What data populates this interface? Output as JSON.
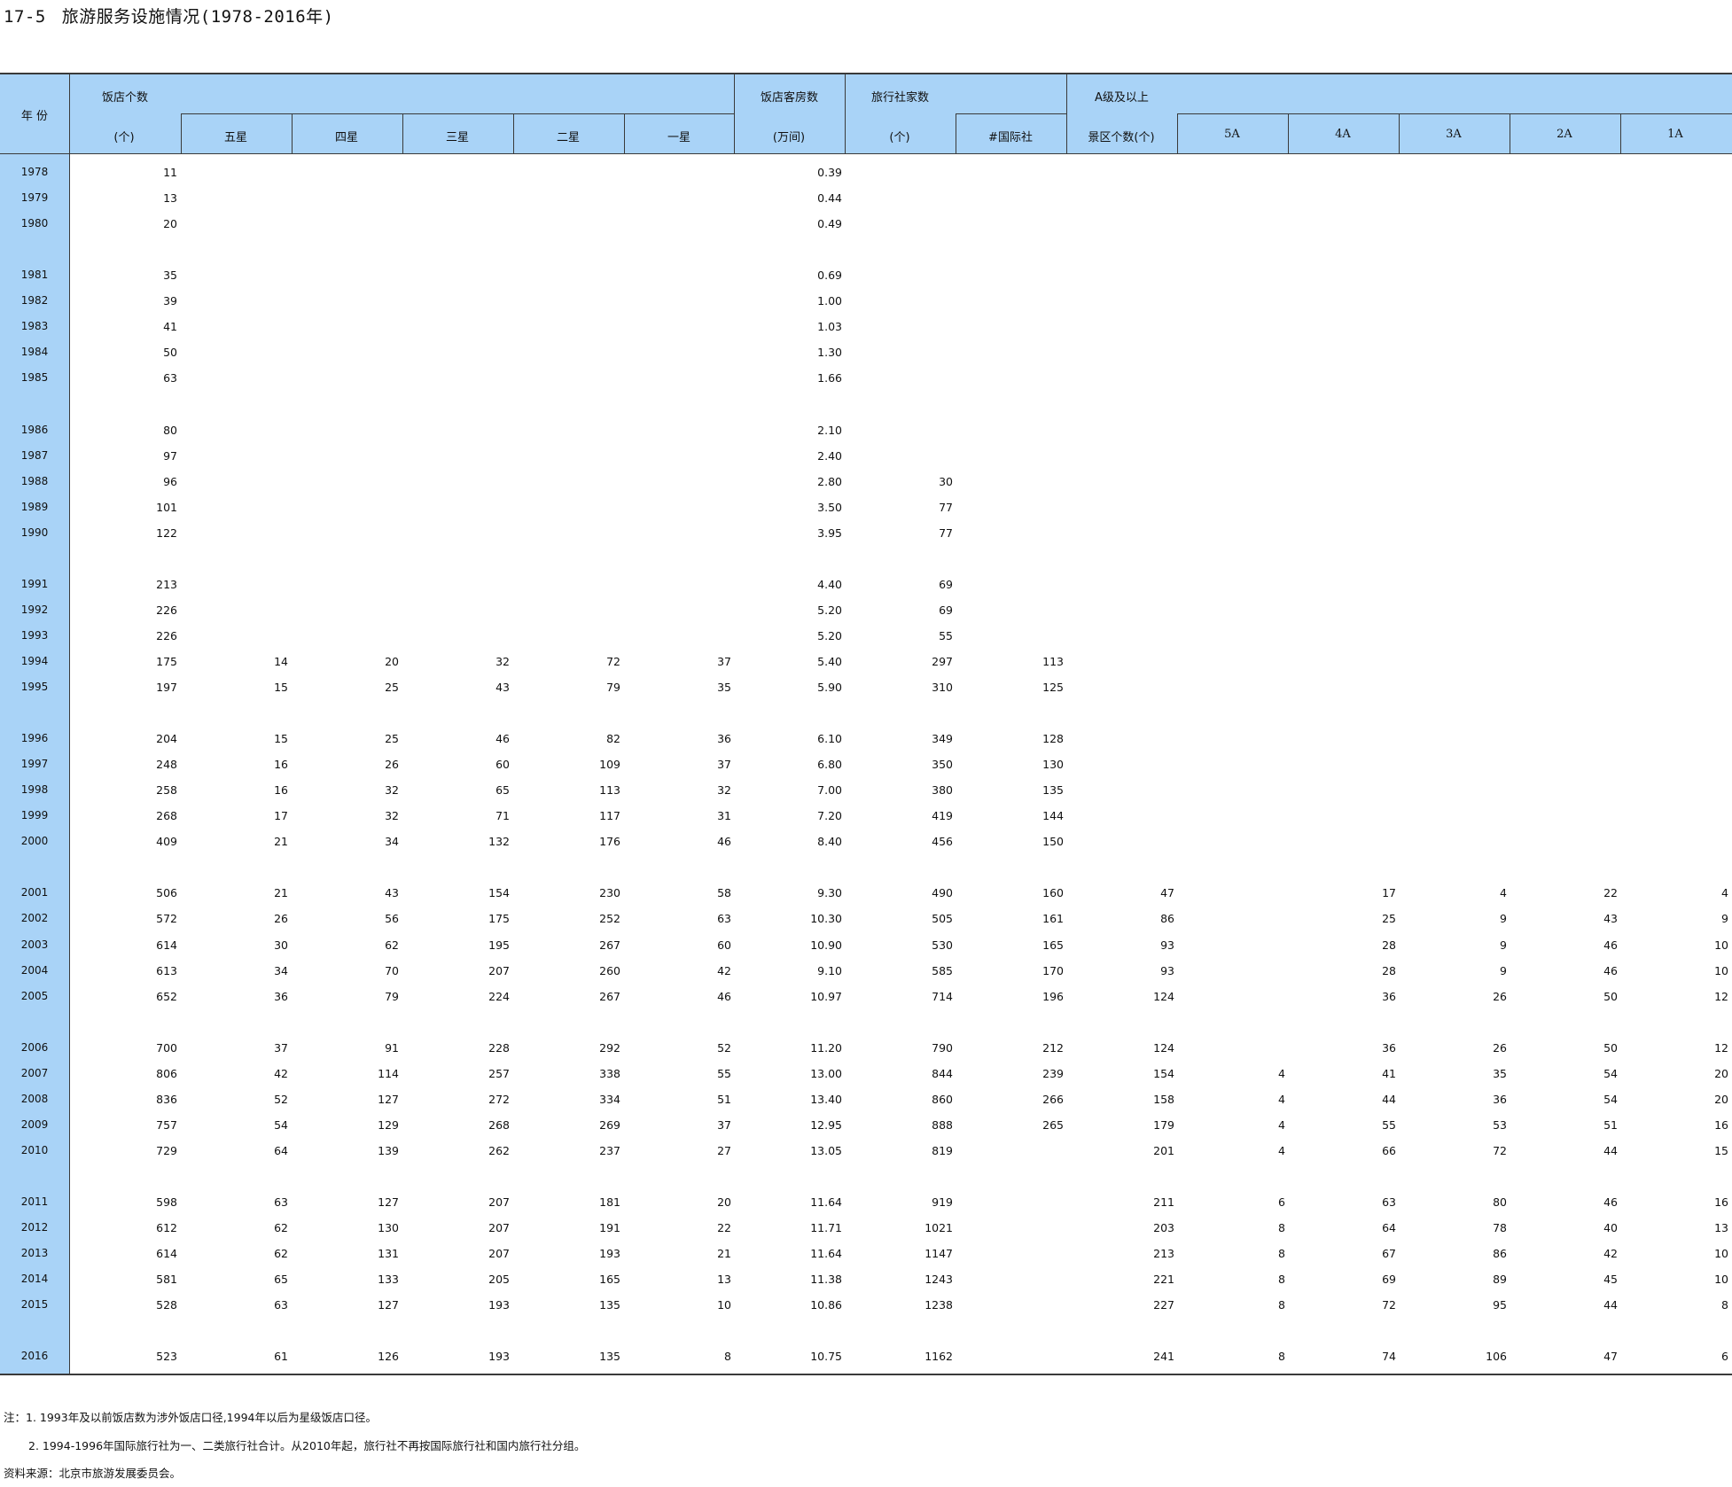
{
  "title": {
    "number": "17-5",
    "text": "旅游服务设施情况(1978-2016年)"
  },
  "header": {
    "year": "年 份",
    "hotels": "饭店个数",
    "hotels_unit": "(个)",
    "five_star": "五星",
    "four_star": "四星",
    "three_star": "三星",
    "two_star": "二星",
    "one_star": "一星",
    "rooms": "饭店客房数",
    "rooms_unit": "(万间)",
    "agencies": "旅行社家数",
    "agencies_unit": "(个)",
    "intl": "#国际社",
    "a_level": "A级及以上",
    "scenic_count": "景区个数(个)",
    "a5": "5A",
    "a4": "4A",
    "a3": "3A",
    "a2": "2A",
    "a1": "1A"
  },
  "columns": [
    "year",
    "hotels",
    "five",
    "four",
    "three",
    "two",
    "one",
    "rooms",
    "agencies",
    "intl",
    "scenic",
    "a5",
    "a4",
    "a3",
    "a2",
    "a1"
  ],
  "rows": [
    [
      "1978",
      "11",
      "",
      "",
      "",
      "",
      "",
      "0.39",
      "",
      "",
      "",
      "",
      "",
      "",
      "",
      ""
    ],
    [
      "1979",
      "13",
      "",
      "",
      "",
      "",
      "",
      "0.44",
      "",
      "",
      "",
      "",
      "",
      "",
      "",
      ""
    ],
    [
      "1980",
      "20",
      "",
      "",
      "",
      "",
      "",
      "0.49",
      "",
      "",
      "",
      "",
      "",
      "",
      "",
      ""
    ],
    [
      "1981",
      "35",
      "",
      "",
      "",
      "",
      "",
      "0.69",
      "",
      "",
      "",
      "",
      "",
      "",
      "",
      ""
    ],
    [
      "1982",
      "39",
      "",
      "",
      "",
      "",
      "",
      "1.00",
      "",
      "",
      "",
      "",
      "",
      "",
      "",
      ""
    ],
    [
      "1983",
      "41",
      "",
      "",
      "",
      "",
      "",
      "1.03",
      "",
      "",
      "",
      "",
      "",
      "",
      "",
      ""
    ],
    [
      "1984",
      "50",
      "",
      "",
      "",
      "",
      "",
      "1.30",
      "",
      "",
      "",
      "",
      "",
      "",
      "",
      ""
    ],
    [
      "1985",
      "63",
      "",
      "",
      "",
      "",
      "",
      "1.66",
      "",
      "",
      "",
      "",
      "",
      "",
      "",
      ""
    ],
    [
      "1986",
      "80",
      "",
      "",
      "",
      "",
      "",
      "2.10",
      "",
      "",
      "",
      "",
      "",
      "",
      "",
      ""
    ],
    [
      "1987",
      "97",
      "",
      "",
      "",
      "",
      "",
      "2.40",
      "",
      "",
      "",
      "",
      "",
      "",
      "",
      ""
    ],
    [
      "1988",
      "96",
      "",
      "",
      "",
      "",
      "",
      "2.80",
      "30",
      "",
      "",
      "",
      "",
      "",
      "",
      ""
    ],
    [
      "1989",
      "101",
      "",
      "",
      "",
      "",
      "",
      "3.50",
      "77",
      "",
      "",
      "",
      "",
      "",
      "",
      ""
    ],
    [
      "1990",
      "122",
      "",
      "",
      "",
      "",
      "",
      "3.95",
      "77",
      "",
      "",
      "",
      "",
      "",
      "",
      ""
    ],
    [
      "1991",
      "213",
      "",
      "",
      "",
      "",
      "",
      "4.40",
      "69",
      "",
      "",
      "",
      "",
      "",
      "",
      ""
    ],
    [
      "1992",
      "226",
      "",
      "",
      "",
      "",
      "",
      "5.20",
      "69",
      "",
      "",
      "",
      "",
      "",
      "",
      ""
    ],
    [
      "1993",
      "226",
      "",
      "",
      "",
      "",
      "",
      "5.20",
      "55",
      "",
      "",
      "",
      "",
      "",
      "",
      ""
    ],
    [
      "1994",
      "175",
      "14",
      "20",
      "32",
      "72",
      "37",
      "5.40",
      "297",
      "113",
      "",
      "",
      "",
      "",
      "",
      ""
    ],
    [
      "1995",
      "197",
      "15",
      "25",
      "43",
      "79",
      "35",
      "5.90",
      "310",
      "125",
      "",
      "",
      "",
      "",
      "",
      ""
    ],
    [
      "1996",
      "204",
      "15",
      "25",
      "46",
      "82",
      "36",
      "6.10",
      "349",
      "128",
      "",
      "",
      "",
      "",
      "",
      ""
    ],
    [
      "1997",
      "248",
      "16",
      "26",
      "60",
      "109",
      "37",
      "6.80",
      "350",
      "130",
      "",
      "",
      "",
      "",
      "",
      ""
    ],
    [
      "1998",
      "258",
      "16",
      "32",
      "65",
      "113",
      "32",
      "7.00",
      "380",
      "135",
      "",
      "",
      "",
      "",
      "",
      ""
    ],
    [
      "1999",
      "268",
      "17",
      "32",
      "71",
      "117",
      "31",
      "7.20",
      "419",
      "144",
      "",
      "",
      "",
      "",
      "",
      ""
    ],
    [
      "2000",
      "409",
      "21",
      "34",
      "132",
      "176",
      "46",
      "8.40",
      "456",
      "150",
      "",
      "",
      "",
      "",
      "",
      ""
    ],
    [
      "2001",
      "506",
      "21",
      "43",
      "154",
      "230",
      "58",
      "9.30",
      "490",
      "160",
      "47",
      "",
      "17",
      "4",
      "22",
      "4"
    ],
    [
      "2002",
      "572",
      "26",
      "56",
      "175",
      "252",
      "63",
      "10.30",
      "505",
      "161",
      "86",
      "",
      "25",
      "9",
      "43",
      "9"
    ],
    [
      "2003",
      "614",
      "30",
      "62",
      "195",
      "267",
      "60",
      "10.90",
      "530",
      "165",
      "93",
      "",
      "28",
      "9",
      "46",
      "10"
    ],
    [
      "2004",
      "613",
      "34",
      "70",
      "207",
      "260",
      "42",
      "9.10",
      "585",
      "170",
      "93",
      "",
      "28",
      "9",
      "46",
      "10"
    ],
    [
      "2005",
      "652",
      "36",
      "79",
      "224",
      "267",
      "46",
      "10.97",
      "714",
      "196",
      "124",
      "",
      "36",
      "26",
      "50",
      "12"
    ],
    [
      "2006",
      "700",
      "37",
      "91",
      "228",
      "292",
      "52",
      "11.20",
      "790",
      "212",
      "124",
      "",
      "36",
      "26",
      "50",
      "12"
    ],
    [
      "2007",
      "806",
      "42",
      "114",
      "257",
      "338",
      "55",
      "13.00",
      "844",
      "239",
      "154",
      "4",
      "41",
      "35",
      "54",
      "20"
    ],
    [
      "2008",
      "836",
      "52",
      "127",
      "272",
      "334",
      "51",
      "13.40",
      "860",
      "266",
      "158",
      "4",
      "44",
      "36",
      "54",
      "20"
    ],
    [
      "2009",
      "757",
      "54",
      "129",
      "268",
      "269",
      "37",
      "12.95",
      "888",
      "265",
      "179",
      "4",
      "55",
      "53",
      "51",
      "16"
    ],
    [
      "2010",
      "729",
      "64",
      "139",
      "262",
      "237",
      "27",
      "13.05",
      "819",
      "",
      "201",
      "4",
      "66",
      "72",
      "44",
      "15"
    ],
    [
      "2011",
      "598",
      "63",
      "127",
      "207",
      "181",
      "20",
      "11.64",
      "919",
      "",
      "211",
      "6",
      "63",
      "80",
      "46",
      "16"
    ],
    [
      "2012",
      "612",
      "62",
      "130",
      "207",
      "191",
      "22",
      "11.71",
      "1021",
      "",
      "203",
      "8",
      "64",
      "78",
      "40",
      "13"
    ],
    [
      "2013",
      "614",
      "62",
      "131",
      "207",
      "193",
      "21",
      "11.64",
      "1147",
      "",
      "213",
      "8",
      "67",
      "86",
      "42",
      "10"
    ],
    [
      "2014",
      "581",
      "65",
      "133",
      "205",
      "165",
      "13",
      "11.38",
      "1243",
      "",
      "221",
      "8",
      "69",
      "89",
      "45",
      "10"
    ],
    [
      "2015",
      "528",
      "63",
      "127",
      "193",
      "135",
      "10",
      "10.86",
      "1238",
      "",
      "227",
      "8",
      "72",
      "95",
      "44",
      "8"
    ],
    [
      "2016",
      "523",
      "61",
      "126",
      "193",
      "135",
      "8",
      "10.75",
      "1162",
      "",
      "241",
      "8",
      "74",
      "106",
      "47",
      "6"
    ]
  ],
  "notes": [
    "注：1. 1993年及以前饭店数为涉外饭店口径,1994年以后为星级饭店口径。",
    "2. 1994-1996年国际旅行社为一、二类旅行社合计。从2010年起，旅行社不再按国际旅行社和国内旅行社分组。",
    "资料来源：北京市旅游发展委员会。"
  ]
}
